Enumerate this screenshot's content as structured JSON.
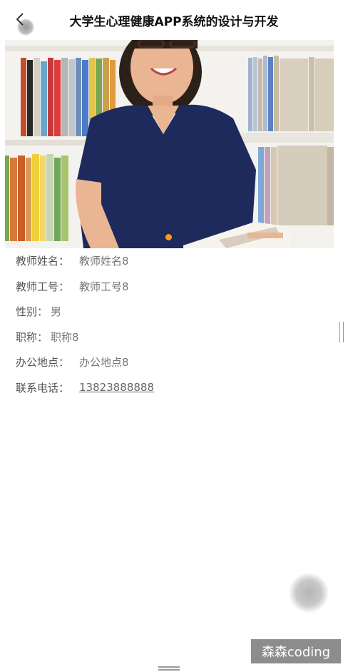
{
  "header": {
    "title": "大学生心理健康APP系统的设计与开发",
    "back_icon": "chevron-left-icon"
  },
  "carousel": {
    "image_desc_icon": "teacher-photo",
    "active_index": 0,
    "indicator_color": "#ff9a1a"
  },
  "teacher": {
    "fields": [
      {
        "label": "教师姓名：",
        "value": "教师姓名8"
      },
      {
        "label": "教师工号：",
        "value": "教师工号8"
      },
      {
        "label": "性别：",
        "value": "男"
      },
      {
        "label": "职称：",
        "value": "职称8"
      },
      {
        "label": "办公地点：",
        "value": "办公地点8"
      },
      {
        "label": "联系电话：",
        "value": "13823888888"
      }
    ]
  },
  "watermark": "森森coding"
}
